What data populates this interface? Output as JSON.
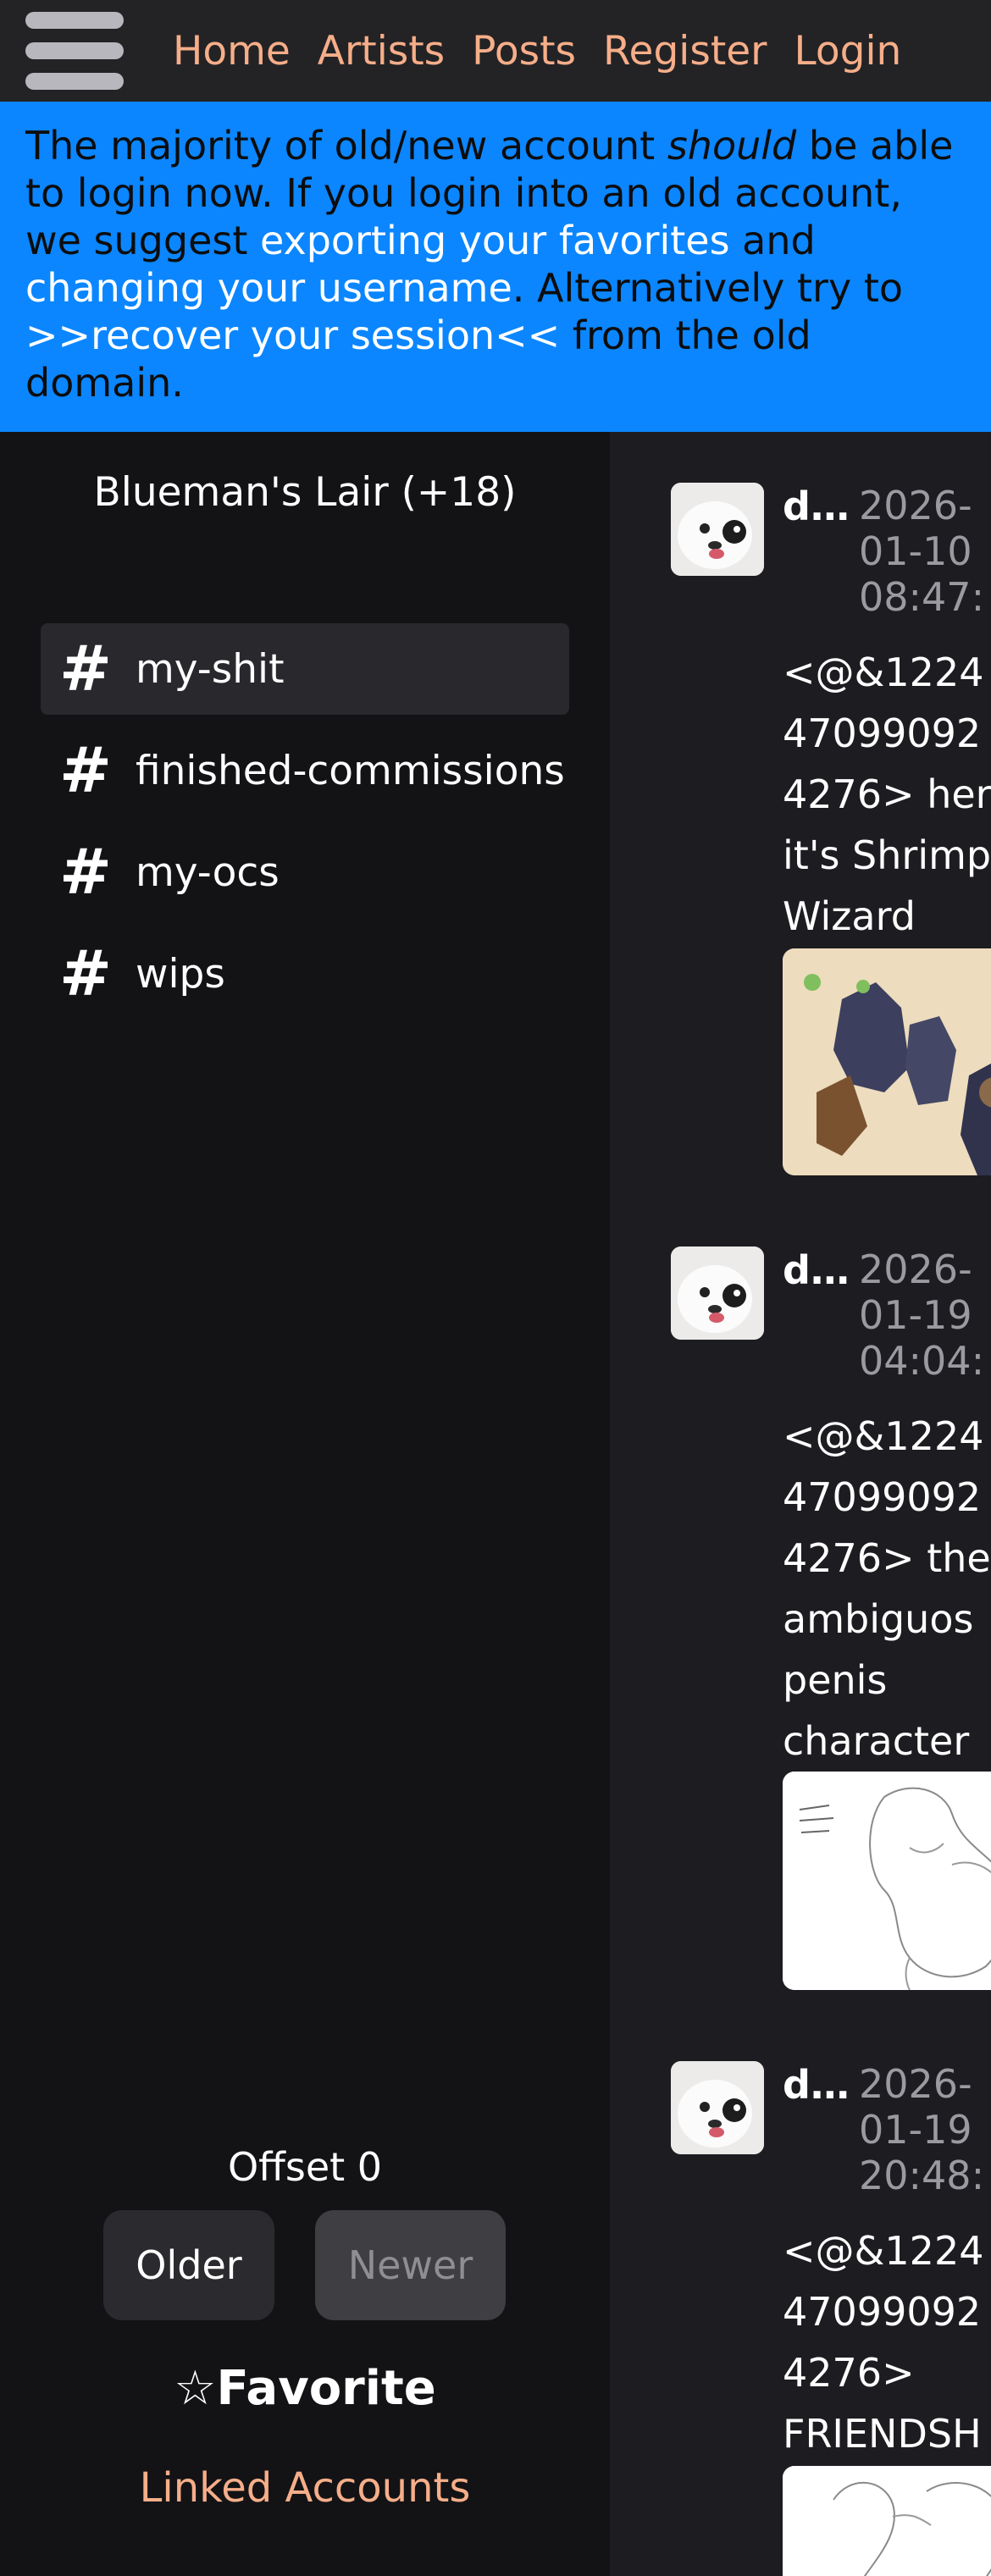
{
  "nav": {
    "links": [
      "Home",
      "Artists",
      "Posts",
      "Register",
      "Login"
    ]
  },
  "banner": {
    "text1": "The majority of old/new account ",
    "text_emph": "should",
    "text2": " be able to login now. If you login into an old account, we suggest ",
    "link_export": "exporting your favorites",
    "text3": " and ",
    "link_change": "changing your username",
    "text4": ". Alternatively try to ",
    "link_recover": ">>recover your session<<",
    "text5": " from the old domain."
  },
  "sidebar": {
    "server_name": "Blueman's Lair (+18)",
    "channels": [
      {
        "label": "my-shit",
        "active": true
      },
      {
        "label": "finished-commissions",
        "active": false
      },
      {
        "label": "my-ocs",
        "active": false
      },
      {
        "label": "wips",
        "active": false
      }
    ],
    "hash_glyph": "#",
    "offset_label": "Offset 0",
    "older_label": "Older",
    "newer_label": "Newer",
    "favorite_label": "☆Favorite",
    "linked_accounts_label": "Linked Accounts"
  },
  "messages": [
    {
      "author": "d…",
      "timestamp": "2026-\n01-10\n08:47:",
      "body": "<@&1224\n47099092\n4276> her\nit's Shrimp\nWizard"
    },
    {
      "author": "d…",
      "timestamp": "2026-\n01-19\n04:04:",
      "body": "<@&1224\n47099092\n4276> the\nambiguos\npenis\ncharacter"
    },
    {
      "author": "d…",
      "timestamp": "2026-\n01-19\n20:48:",
      "body": "<@&1224\n47099092\n4276>\nFRIENDSH"
    }
  ],
  "colors": {
    "accent_link": "#f6ae89",
    "banner_bg": "#0b86ff"
  }
}
